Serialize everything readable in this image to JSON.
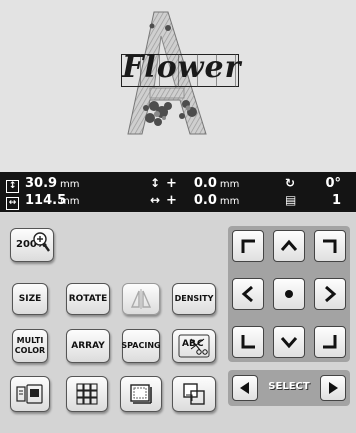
{
  "preview": {
    "design_text": "Flower"
  },
  "info": {
    "height_value": "30.9",
    "height_unit": "mm",
    "width_value": "114.5",
    "width_unit": "mm",
    "v_offset_sign": "+",
    "v_offset_value": "0.0",
    "v_offset_unit": "mm",
    "h_offset_sign": "+",
    "h_offset_value": "0.0",
    "h_offset_unit": "mm",
    "angle_value": "0°",
    "page_value": "1"
  },
  "buttons": {
    "zoom": "200%",
    "size": "SIZE",
    "rotate": "ROTATE",
    "density": "DENSITY",
    "multi_color_1": "MULTI",
    "multi_color_2": "COLOR",
    "array": "ARRAY",
    "spacing": "SPACING",
    "select": "SELECT"
  }
}
